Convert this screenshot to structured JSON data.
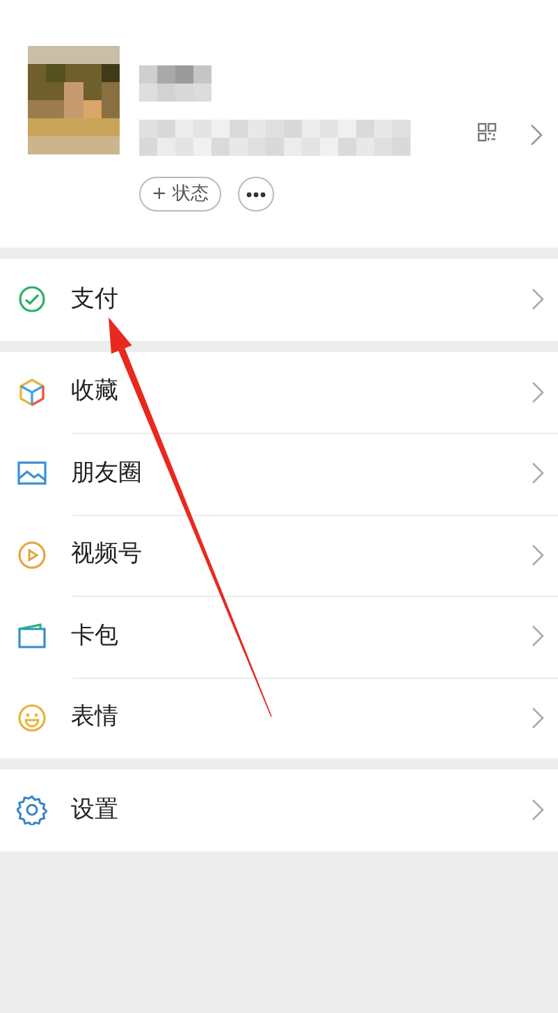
{
  "header": {
    "status_button": "+ 状态"
  },
  "sections": [
    [
      {
        "kind": "pay",
        "label": "支付"
      }
    ],
    [
      {
        "kind": "favorites",
        "label": "收藏"
      },
      {
        "kind": "moments",
        "label": "朋友圈"
      },
      {
        "kind": "channels",
        "label": "视频号"
      },
      {
        "kind": "cards",
        "label": "卡包"
      },
      {
        "kind": "stickers",
        "label": "表情"
      }
    ],
    [
      {
        "kind": "settings",
        "label": "设置"
      }
    ]
  ]
}
